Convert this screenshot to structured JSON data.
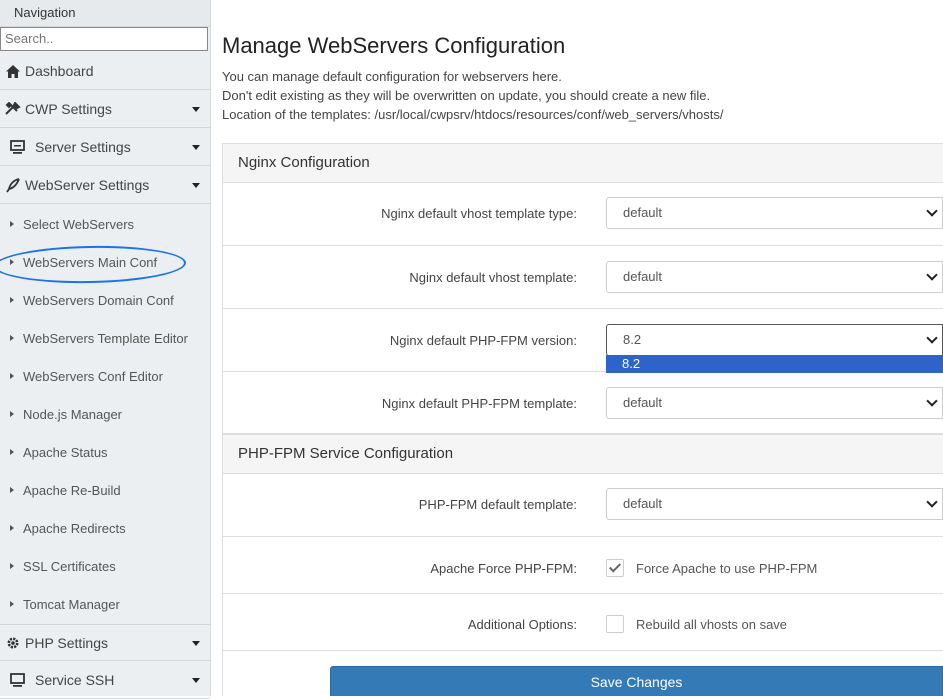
{
  "sidebar": {
    "header": "Navigation",
    "search_placeholder": "Search..",
    "items": [
      {
        "label": "Dashboard",
        "icon": "home-icon"
      },
      {
        "label": "CWP Settings",
        "icon": "tools-icon"
      },
      {
        "label": "Server Settings",
        "icon": "monitor-icon"
      },
      {
        "label": "WebServer Settings",
        "icon": "feather-icon"
      }
    ],
    "sub_items": [
      "Select WebServers",
      "WebServers Main Conf",
      "WebServers Domain Conf",
      "WebServers Template Editor",
      "WebServers Conf Editor",
      "Node.js Manager",
      "Apache Status",
      "Apache Re-Build",
      "Apache Redirects",
      "SSL Certificates",
      "Tomcat Manager"
    ],
    "bottom_items": [
      {
        "label": "PHP Settings",
        "icon": "gear-icon"
      },
      {
        "label": "Service SSH",
        "icon": "monitor-icon"
      }
    ],
    "highlighted_item": "WebServers Main Conf"
  },
  "main": {
    "title": "Manage WebServers Configuration",
    "desc": [
      "You can manage default configuration for webservers here.",
      "Don't edit existing as they will be overwritten on update, you should create a new file.",
      "Location of the templates: /usr/local/cwpsrv/htdocs/resources/conf/web_servers/vhosts/"
    ],
    "nginx": {
      "heading": "Nginx Configuration",
      "rows": [
        {
          "label": "Nginx default vhost template type:",
          "value": "default"
        },
        {
          "label": "Nginx default vhost template:",
          "value": "default"
        },
        {
          "label": "Nginx default PHP-FPM version:",
          "value": "8.2",
          "dropdown_option": "8.2"
        },
        {
          "label": "Nginx default PHP-FPM template:",
          "value": "default"
        }
      ]
    },
    "phpfpm": {
      "heading": "PHP-FPM Service Configuration",
      "template_label": "PHP-FPM default template:",
      "template_value": "default",
      "force_label": "Apache Force PHP-FPM:",
      "force_checkbox_label": "Force Apache to use PHP-FPM",
      "force_checked": true,
      "additional_label": "Additional Options:",
      "rebuild_checkbox_label": "Rebuild all vhosts on save",
      "rebuild_checked": false
    },
    "save_label": "Save Changes"
  },
  "colors": {
    "sidebar_bg": "#eceff1",
    "primary_button": "#337ab7",
    "dropdown_highlight": "#2e63c9",
    "annotation_ring": "#1a73e8"
  }
}
